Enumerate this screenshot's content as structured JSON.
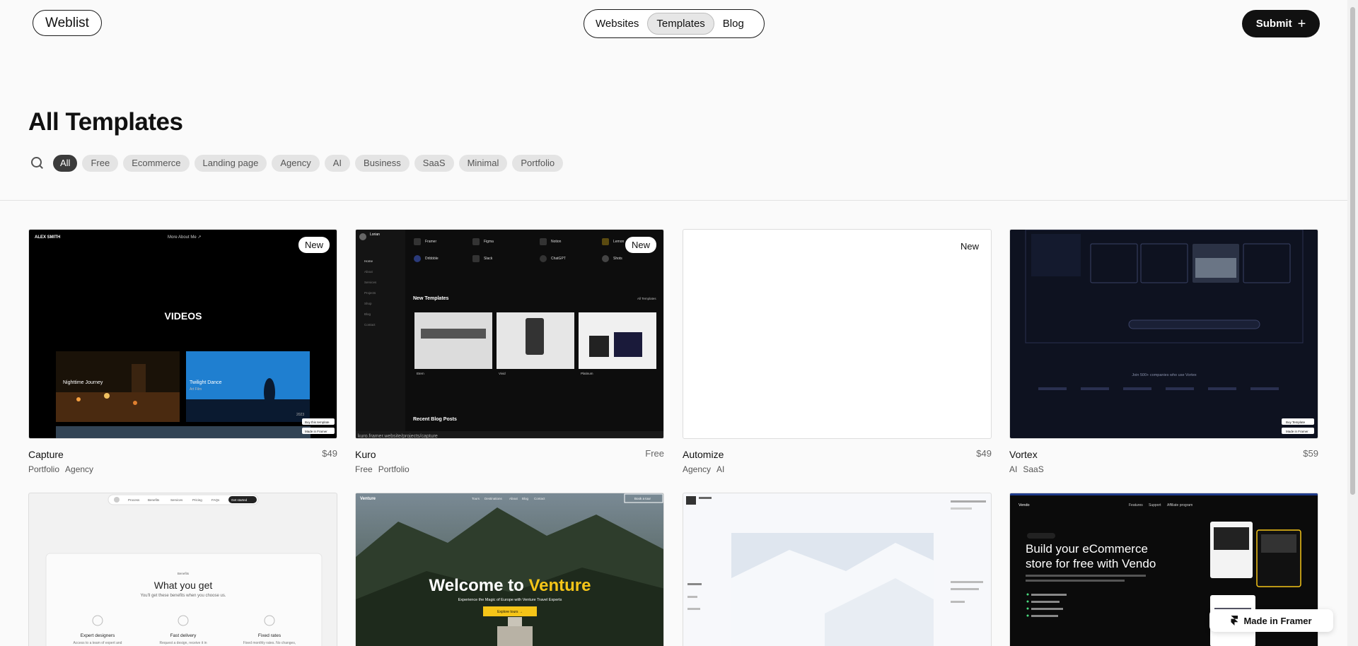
{
  "header": {
    "logo": "Weblist",
    "nav": [
      {
        "label": "Websites",
        "active": false
      },
      {
        "label": "Templates",
        "active": true
      },
      {
        "label": "Blog",
        "active": false
      }
    ],
    "submit_label": "Submit"
  },
  "page": {
    "title": "All Templates",
    "filters": [
      "All",
      "Free",
      "Ecommerce",
      "Landing page",
      "Agency",
      "AI",
      "Business",
      "SaaS",
      "Minimal",
      "Portfolio"
    ],
    "active_filter": "All"
  },
  "cards": [
    {
      "name": "Capture",
      "price": "$49",
      "tags": [
        "Portfolio",
        "Agency"
      ],
      "badge": "New",
      "thumb": {
        "brand": "ALEX SMITH",
        "nav": "More About Me ↗",
        "hero": "VIDEOS",
        "clip1": "Nighttime Journey",
        "clip2": "Twilight Dance",
        "clip2_sub": "Art Film",
        "year": "2023",
        "cta": "Buy this template",
        "made": "Made in Framer"
      }
    },
    {
      "name": "Kuro",
      "price": "Free",
      "tags": [
        "Free",
        "Portfolio"
      ],
      "badge": "New",
      "thumb": {
        "user": "Lorian",
        "section1": "New Templates",
        "all": "All Templates",
        "section2": "Recent Blog Posts",
        "url": "kuro.framer.website/projects/capture",
        "items": [
          "Framer",
          "Figma",
          "Notion",
          "Lemon",
          "Dribbble",
          "Slack",
          "ChatGPT",
          "Shots"
        ],
        "side": [
          "Home",
          "About",
          "Services",
          "Projects",
          "Shop",
          "Blog",
          "Contact"
        ],
        "cards": [
          "Etern",
          "Vivid",
          "Platinum"
        ]
      }
    },
    {
      "name": "Automize",
      "price": "$49",
      "tags": [
        "Agency",
        "AI"
      ],
      "badge": "New",
      "thumb": {}
    },
    {
      "name": "Vortex",
      "price": "$59",
      "tags": [
        "AI",
        "SaaS"
      ],
      "badge": "",
      "thumb": {
        "companies": "Join 500+ companies who use Vortex",
        "cta": "Buy Template",
        "made": "Made in Framer"
      }
    },
    {
      "name": "",
      "price": "",
      "tags": [],
      "badge": "",
      "thumb": {
        "nav": [
          "Process",
          "Benefits",
          "Services",
          "Pricing",
          "FAQs"
        ],
        "cta": "Get started",
        "kicker": "Benefits",
        "title": "What you get",
        "sub": "You'll get these benefits when you choose us.",
        "features": [
          "Expert designers",
          "Fast delivery",
          "Fixed rates"
        ],
        "feature_subs": [
          "Access to a team of expert and",
          "Request a design, receive it in",
          "Fixed monthly rates. No changes,"
        ]
      }
    },
    {
      "name": "",
      "price": "",
      "tags": [],
      "badge": "",
      "thumb": {
        "brand": "Venture",
        "nav": [
          "Tours",
          "Destinations",
          "About",
          "Blog",
          "Contact"
        ],
        "book": "Book a tour",
        "title_a": "Welcome to ",
        "title_b": "Venture",
        "sub": "Experience the Magic of Europe with Venture Travel Experts",
        "cta": "Explore tours →"
      }
    },
    {
      "name": "",
      "price": "",
      "tags": [],
      "badge": "",
      "thumb": {}
    },
    {
      "name": "",
      "price": "",
      "tags": [],
      "badge": "",
      "thumb": {
        "brand": "Vendo",
        "nav": [
          "Features",
          "Support",
          "Affiliate program"
        ],
        "title_1": "Build your eCommerce",
        "title_2": "store for free with Vendo"
      }
    }
  ],
  "framer_badge": "Made in Framer",
  "colors": {
    "accent_yellow": "#f5c518",
    "dark": "#111111",
    "chip_active": "#3b3b3b"
  }
}
